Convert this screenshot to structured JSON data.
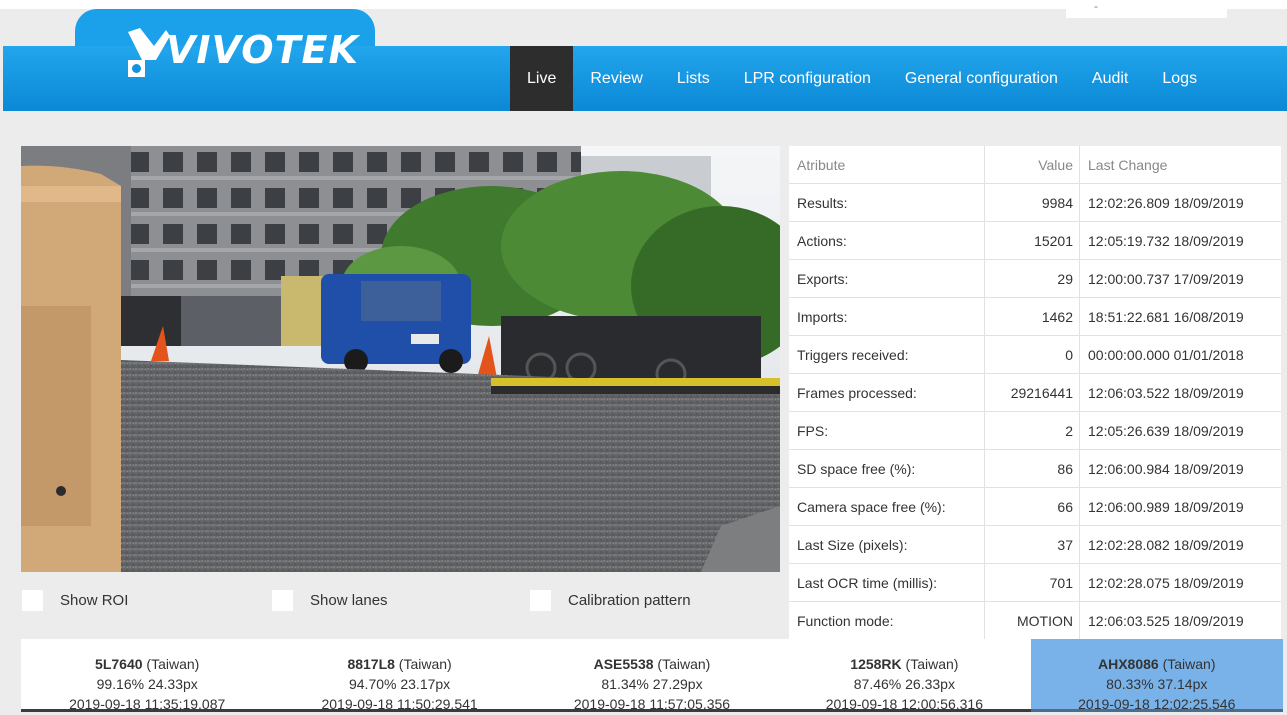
{
  "brand": {
    "logo_text": "VIVOTEK"
  },
  "corner": {
    "text": "-"
  },
  "nav": [
    {
      "label": "Live",
      "active": true
    },
    {
      "label": "Review"
    },
    {
      "label": "Lists"
    },
    {
      "label": "LPR configuration"
    },
    {
      "label": "General configuration"
    },
    {
      "label": "Audit"
    },
    {
      "label": "Logs"
    }
  ],
  "options": {
    "show_roi": "Show ROI",
    "show_lanes": "Show lanes",
    "calibration": "Calibration pattern"
  },
  "stats": {
    "headers": {
      "attribute": "Atribute",
      "value": "Value",
      "last_change": "Last Change"
    },
    "rows": [
      {
        "attribute": "Results:",
        "value": "9984",
        "last_change": "12:02:26.809 18/09/2019"
      },
      {
        "attribute": "Actions:",
        "value": "15201",
        "last_change": "12:05:19.732 18/09/2019"
      },
      {
        "attribute": "Exports:",
        "value": "29",
        "last_change": "12:00:00.737 17/09/2019"
      },
      {
        "attribute": "Imports:",
        "value": "1462",
        "last_change": "18:51:22.681 16/08/2019"
      },
      {
        "attribute": "Triggers received:",
        "value": "0",
        "last_change": "00:00:00.000 01/01/2018"
      },
      {
        "attribute": "Frames processed:",
        "value": "29216441",
        "last_change": "12:06:03.522 18/09/2019"
      },
      {
        "attribute": "FPS:",
        "value": "2",
        "last_change": "12:05:26.639 18/09/2019"
      },
      {
        "attribute": "SD space free (%):",
        "value": "86",
        "last_change": "12:06:00.984 18/09/2019"
      },
      {
        "attribute": "Camera space free (%):",
        "value": "66",
        "last_change": "12:06:00.989 18/09/2019"
      },
      {
        "attribute": "Last Size (pixels):",
        "value": "37",
        "last_change": "12:02:28.082 18/09/2019"
      },
      {
        "attribute": "Last OCR time (millis):",
        "value": "701",
        "last_change": "12:02:28.075 18/09/2019"
      },
      {
        "attribute": "Function mode:",
        "value": "MOTION",
        "last_change": "12:06:03.525 18/09/2019"
      }
    ]
  },
  "plates": [
    {
      "number": "5L7640",
      "country": " (Taiwan)",
      "metrics": "99.16% 24.33px",
      "time": "2019-09-18 11:35:19.087"
    },
    {
      "number": "8817L8",
      "country": " (Taiwan)",
      "metrics": "94.70% 23.17px",
      "time": "2019-09-18 11:50:29.541"
    },
    {
      "number": "ASE5538",
      "country": " (Taiwan)",
      "metrics": "81.34% 27.29px",
      "time": "2019-09-18 11:57:05.356"
    },
    {
      "number": "1258RK",
      "country": " (Taiwan)",
      "metrics": "87.46% 26.33px",
      "time": "2019-09-18 12:00:56.316"
    },
    {
      "number": "AHX8086",
      "country": " (Taiwan)",
      "metrics": "80.33% 37.14px",
      "time": "2019-09-18 12:02:25.546",
      "selected": true
    }
  ],
  "colors": {
    "header_blue": "#1796e0",
    "active_nav": "#2d2d2d",
    "selected_plate": "#79b2e8"
  }
}
